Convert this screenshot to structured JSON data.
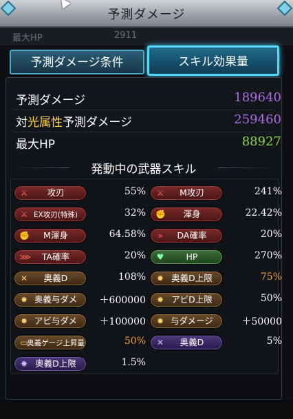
{
  "window": {
    "title": "予測ダメージ"
  },
  "background_row": {
    "left": "最大HP",
    "right": "2911"
  },
  "tabs": [
    {
      "label": "予測ダメージ条件",
      "active": false
    },
    {
      "label": "スキル効果量",
      "active": true
    }
  ],
  "stats": {
    "predicted_damage": {
      "label": "予測ダメージ",
      "value": "189640",
      "color": "#b06ae8"
    },
    "element_damage": {
      "prefix": "対",
      "element": "光属性",
      "suffix": "予測ダメージ",
      "value": "259460",
      "color": "#b06ae8"
    },
    "max_hp": {
      "label": "最大HP",
      "value": "88927",
      "color": "#8ad84a"
    }
  },
  "skills_title": "発動中の武器スキル",
  "skills": [
    [
      {
        "name": "攻刃",
        "icon": "sword-icon",
        "style": "red",
        "value": "55%",
        "color": "#ffffff"
      },
      {
        "name": "M攻刃",
        "icon": "sword-icon",
        "style": "red",
        "value": "241%",
        "color": "#ffffff"
      }
    ],
    [
      {
        "name": "EX攻刃(特殊)",
        "icon": "sword-icon",
        "style": "red",
        "value": "32%",
        "color": "#ffffff"
      },
      {
        "name": "渾身",
        "icon": "flex-icon",
        "style": "red",
        "value": "22.42%",
        "color": "#ffffff"
      }
    ],
    [
      {
        "name": "M渾身",
        "icon": "flex-icon",
        "style": "red",
        "value": "64.58%",
        "color": "#ffffff"
      },
      {
        "name": "DA確率",
        "icon": "double-chevron-icon",
        "style": "red",
        "value": "20%",
        "color": "#ffffff"
      }
    ],
    [
      {
        "name": "TA確率",
        "icon": "triple-chevron-icon",
        "style": "red",
        "value": "20%",
        "color": "#ffffff"
      },
      {
        "name": "HP",
        "icon": "heart-icon",
        "style": "green",
        "value": "270%",
        "color": "#ffffff"
      }
    ],
    [
      {
        "name": "奥義D",
        "icon": "cross-swords-icon",
        "style": "brown",
        "value": "108%",
        "color": "#ffffff"
      },
      {
        "name": "奥義D上限",
        "icon": "burst-icon",
        "style": "brown",
        "value": "75%",
        "color": "#f0a040"
      }
    ],
    [
      {
        "name": "奥義与ダメ",
        "icon": "burst-icon",
        "style": "brown",
        "value": "＋600000",
        "color": "#ffffff"
      },
      {
        "name": "アビD上限",
        "icon": "burst-icon",
        "style": "brown",
        "value": "50%",
        "color": "#ffffff"
      }
    ],
    [
      {
        "name": "アビ与ダメ",
        "icon": "burst-icon",
        "style": "brown",
        "value": "＋100000",
        "color": "#ffffff"
      },
      {
        "name": "与ダメージ",
        "icon": "gear-icon",
        "style": "brown",
        "value": "＋50000",
        "color": "#ffffff"
      }
    ],
    [
      {
        "name": "奥義ゲージ上昇量",
        "icon": "gauge-icon",
        "style": "brown",
        "value": "50%",
        "color": "#f0a040"
      },
      {
        "name": "奥義D",
        "icon": "cross-swords-icon",
        "style": "purple",
        "value": "5%",
        "color": "#ffffff"
      }
    ],
    [
      {
        "name": "奥義D上限",
        "icon": "burst-icon",
        "style": "purple",
        "value": "1.5%",
        "color": "#ffffff"
      },
      null
    ]
  ]
}
